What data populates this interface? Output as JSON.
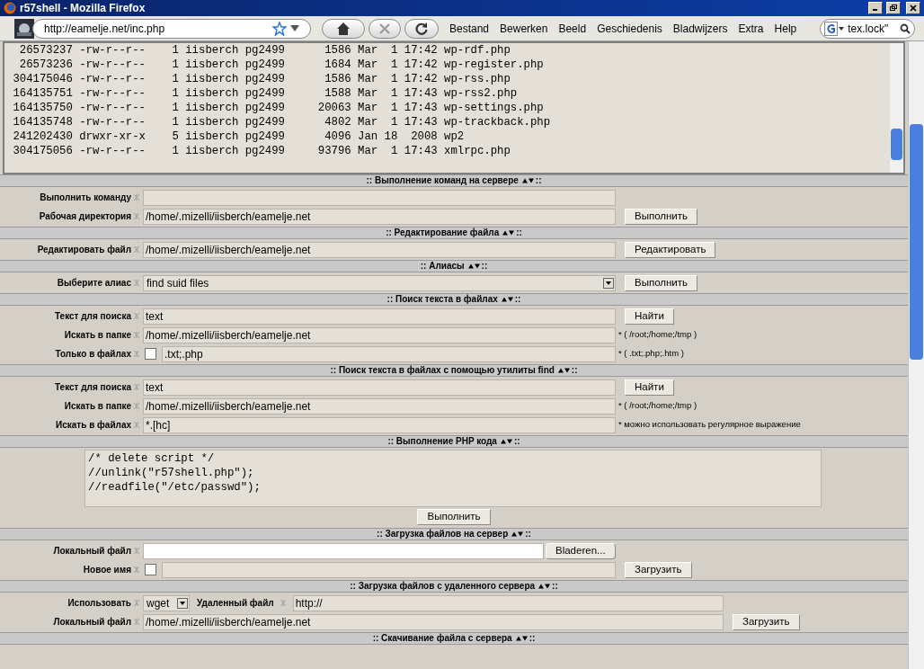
{
  "window": {
    "title": "r57shell - Mozilla Firefox"
  },
  "toolbar": {
    "url": "http://eamelje.net/inc.php",
    "menu": [
      "Bestand",
      "Bewerken",
      "Beeld",
      "Geschiedenis",
      "Bladwijzers",
      "Extra",
      "Help"
    ],
    "search": "tex.lock\""
  },
  "listing": [
    "  26573237 -rw-r--r--    1 iisberch pg2499      1586 Mar  1 17:42 wp-rdf.php",
    "  26573236 -rw-r--r--    1 iisberch pg2499      1684 Mar  1 17:42 wp-register.php",
    " 304175046 -rw-r--r--    1 iisberch pg2499      1586 Mar  1 17:42 wp-rss.php",
    " 164135751 -rw-r--r--    1 iisberch pg2499      1588 Mar  1 17:43 wp-rss2.php",
    " 164135750 -rw-r--r--    1 iisberch pg2499     20063 Mar  1 17:43 wp-settings.php",
    " 164135748 -rw-r--r--    1 iisberch pg2499      4802 Mar  1 17:43 wp-trackback.php",
    " 241202430 drwxr-xr-x    5 iisberch pg2499      4096 Jan 18  2008 wp2",
    " 304175056 -rw-r--r--    1 iisberch pg2499     93796 Mar  1 17:43 xmlrpc.php"
  ],
  "sections": [
    {
      "title": ":: Выполнение команд на сервере",
      "rows": [
        {
          "label": "Выполнить команду",
          "items": [
            {
              "kind": "field"
            }
          ]
        },
        {
          "label": "Рабочая директория",
          "items": [
            {
              "kind": "field",
              "value": "/home/.mizelli/iisberch/eamelje.net"
            },
            {
              "kind": "button",
              "text": "Выполнить"
            }
          ]
        }
      ],
      "title_end": "::"
    },
    {
      "title": ":: Редактирование файла",
      "rows": [
        {
          "label": "Редактировать файл",
          "items": [
            {
              "kind": "field",
              "value": "/home/.mizelli/iisberch/eamelje.net"
            },
            {
              "kind": "button",
              "text": "Редактировать"
            }
          ]
        }
      ],
      "title_end": "::"
    },
    {
      "title": ":: Алиасы",
      "rows": [
        {
          "label": "Выберите алиас",
          "items": [
            {
              "kind": "select",
              "value": "find suid files"
            },
            {
              "kind": "button",
              "text": "Выполнить"
            }
          ]
        }
      ],
      "title_end": "::"
    },
    {
      "title": ":: Поиск текста в файлах",
      "rows": [
        {
          "label": "Текст для поиска",
          "items": [
            {
              "kind": "field",
              "value": "text"
            },
            {
              "kind": "button",
              "text": "Найти"
            }
          ]
        },
        {
          "label": "Искать в папке",
          "items": [
            {
              "kind": "field",
              "value": "/home/.mizelli/iisberch/eamelje.net"
            },
            {
              "kind": "hint",
              "text": "* ( /root;/home;/tmp )"
            }
          ]
        },
        {
          "label": "Только в файлах",
          "items": [
            {
              "kind": "checkbox",
              "checked": false
            },
            {
              "kind": "field",
              "value": ".txt;.php"
            },
            {
              "kind": "hint",
              "text": "* ( .txt;.php;.htm )"
            }
          ]
        }
      ],
      "title_end": "::"
    },
    {
      "title": ":: Поиск текста в файлах с помощью утилиты find",
      "rows": [
        {
          "label": "Текст для поиска",
          "items": [
            {
              "kind": "field",
              "value": "text"
            },
            {
              "kind": "button",
              "text": "Найти"
            }
          ]
        },
        {
          "label": "Искать в папке",
          "items": [
            {
              "kind": "field",
              "value": "/home/.mizelli/iisberch/eamelje.net"
            },
            {
              "kind": "hint",
              "text": "* ( /root;/home;/tmp )"
            }
          ]
        },
        {
          "label": "Искать в файлах",
          "items": [
            {
              "kind": "field",
              "value": "*.[hc]"
            },
            {
              "kind": "hint",
              "text": "* можно использовать регулярное выражение"
            }
          ]
        }
      ],
      "title_end": "::"
    },
    {
      "title": ":: Выполнение PHP кода",
      "code": [
        "/* delete script */",
        "//unlink(\"r57shell.php\");",
        "//readfile(\"/etc/passwd\");"
      ],
      "button": "Выполнить",
      "title_end": "::"
    },
    {
      "title": ":: Загрузка файлов на сервер",
      "rows": [
        {
          "label": "Локальный файл",
          "items": [
            {
              "kind": "file"
            },
            {
              "kind": "button",
              "text": "Bladeren..."
            }
          ]
        },
        {
          "label": "Новое имя",
          "items": [
            {
              "kind": "checkbox",
              "checked": false
            },
            {
              "kind": "field"
            },
            {
              "kind": "button",
              "text": "Загрузить"
            }
          ]
        }
      ],
      "title_end": "::"
    },
    {
      "title": ":: Загрузка файлов с удаленного сервера",
      "rows": [
        {
          "label": "Использовать",
          "items": [
            {
              "kind": "select",
              "value": "wget"
            },
            {
              "kind": "label",
              "text": "Удаленный файл"
            },
            {
              "kind": "long_field",
              "value": "http://"
            }
          ]
        },
        {
          "label": "Локальный файл",
          "items": [
            {
              "kind": "long_field",
              "value": "/home/.mizelli/iisberch/eamelje.net"
            },
            {
              "kind": "button",
              "text": "Загрузить"
            }
          ]
        }
      ],
      "title_end": "::"
    },
    {
      "title": ":: Скачивание файла с сервера",
      "title_end": "::"
    }
  ]
}
